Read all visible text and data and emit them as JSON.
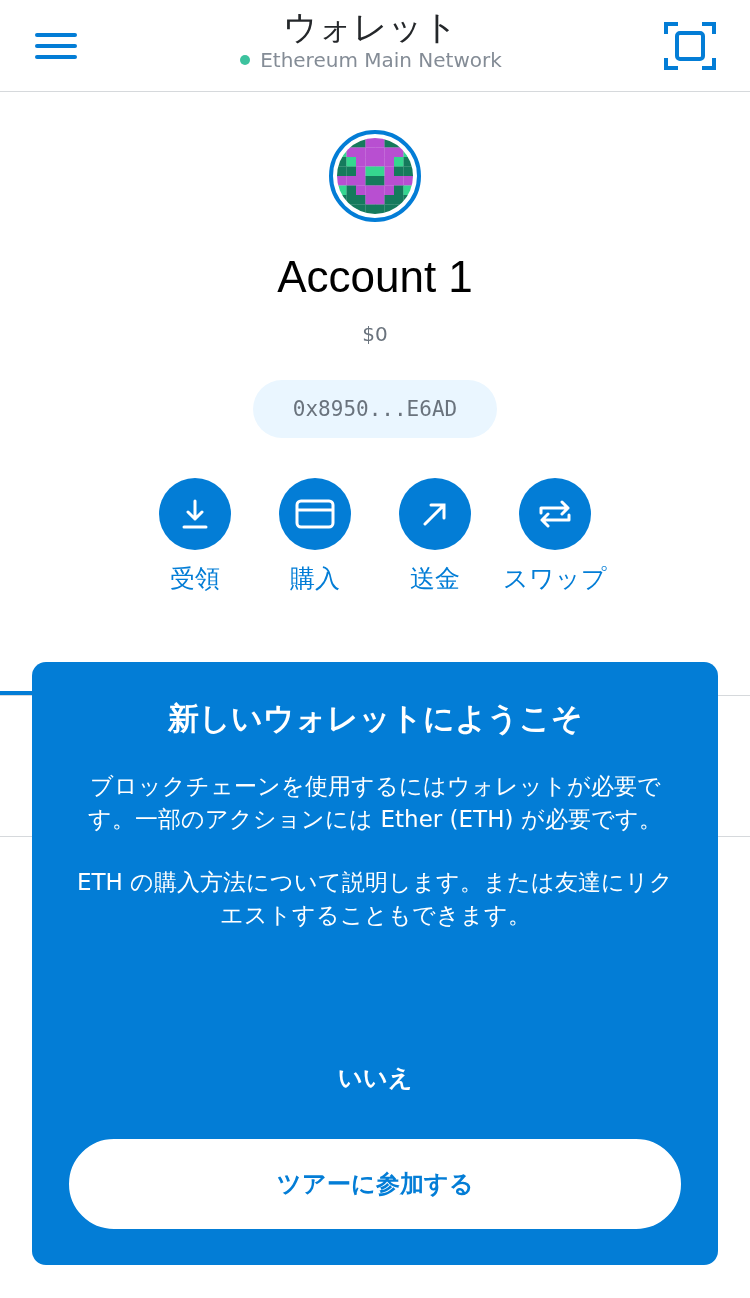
{
  "header": {
    "title": "ウォレット",
    "network": "Ethereum Main Network"
  },
  "account": {
    "name": "Account 1",
    "balance": "$0",
    "address": "0x8950...E6AD"
  },
  "actions": [
    {
      "kind": "receive",
      "label": "受領"
    },
    {
      "kind": "buy",
      "label": "購入"
    },
    {
      "kind": "send",
      "label": "送金"
    },
    {
      "kind": "swap",
      "label": "スワップ"
    }
  ],
  "tabs": [
    {
      "selected": true
    },
    {
      "selected": false
    }
  ],
  "modal": {
    "title": "新しいウォレットにようこそ",
    "paragraphs": [
      "ブロックチェーンを使用するにはウォレットが必要です。一部のアクションには Ether (ETH) が必要です。",
      "ETH の購入方法について説明します。または友達にリクエストすることもできます。"
    ],
    "secondary": "いいえ",
    "primary": "ツアーに参加する"
  }
}
